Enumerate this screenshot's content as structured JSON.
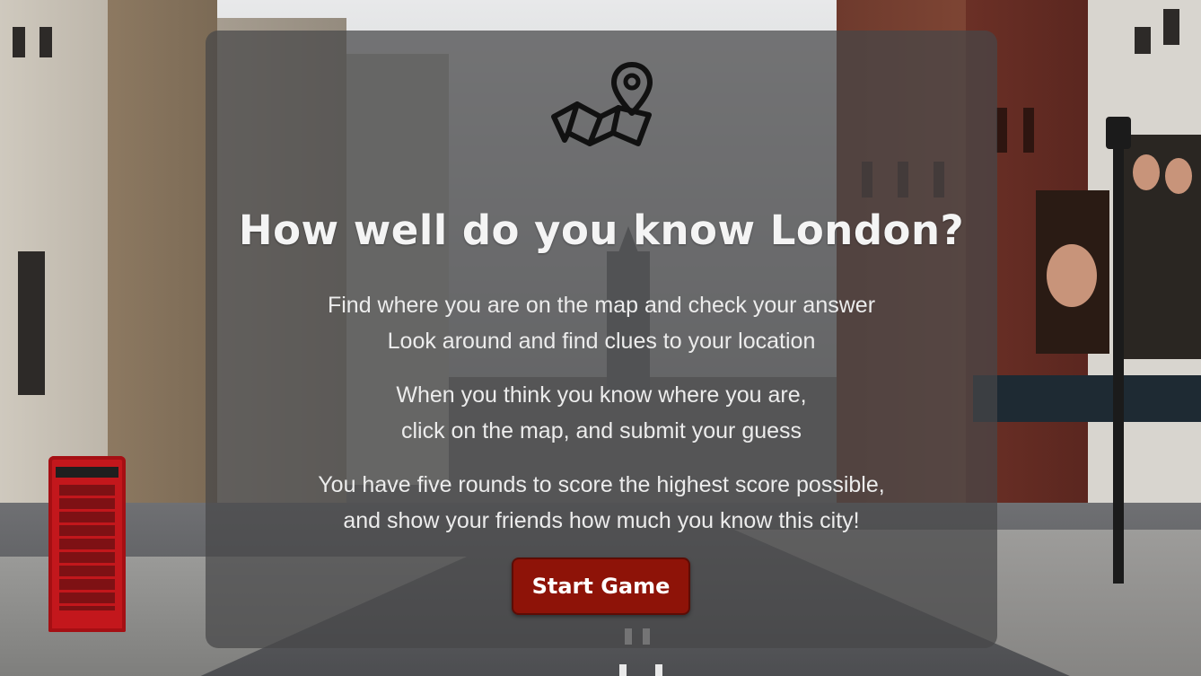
{
  "page": {
    "title": "How well do you know London?",
    "instructions": {
      "p1_line1": "Find where you are on the map and check your answer",
      "p1_line2": "Look around and find clues to your location",
      "p2_line1": "When you think you know where you are,",
      "p2_line2": "click on the map, and submit your guess",
      "p3_line1": "You have five rounds to score the highest score possible,",
      "p3_line2": "and show your friends how much you know this city!"
    },
    "start_button_label": "Start Game",
    "icon": "map-pin-icon"
  },
  "colors": {
    "overlay": "#464648",
    "button": "#8e1308",
    "text": "#f2f2f2"
  }
}
